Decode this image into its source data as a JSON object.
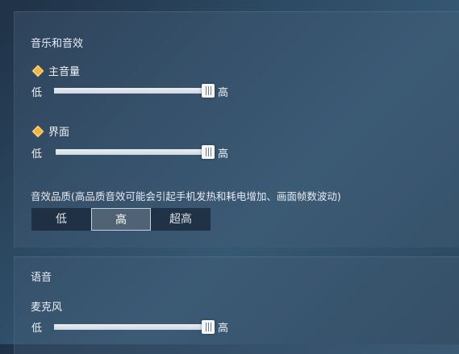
{
  "audio_panel": {
    "title": "音乐和音效",
    "master_volume": {
      "label": "主音量",
      "low": "低",
      "high": "高",
      "value": 1.0
    },
    "interface_volume": {
      "label": "界面",
      "low": "低",
      "high": "高",
      "value": 1.0
    },
    "quality": {
      "description": "音效品质(高品质音效可能会引起手机发热和耗电增加、画面帧数波动)",
      "options": [
        "低",
        "高",
        "超高"
      ],
      "selected": "高"
    }
  },
  "voice_panel": {
    "title": "语音",
    "microphone": {
      "label": "麦克风",
      "low": "低",
      "high": "高",
      "value": 1.0
    }
  },
  "colors": {
    "accent_diamond": "#f0b640",
    "slider_fill": "#e9eef2"
  },
  "icons": {
    "option_marker": "diamond-icon"
  }
}
